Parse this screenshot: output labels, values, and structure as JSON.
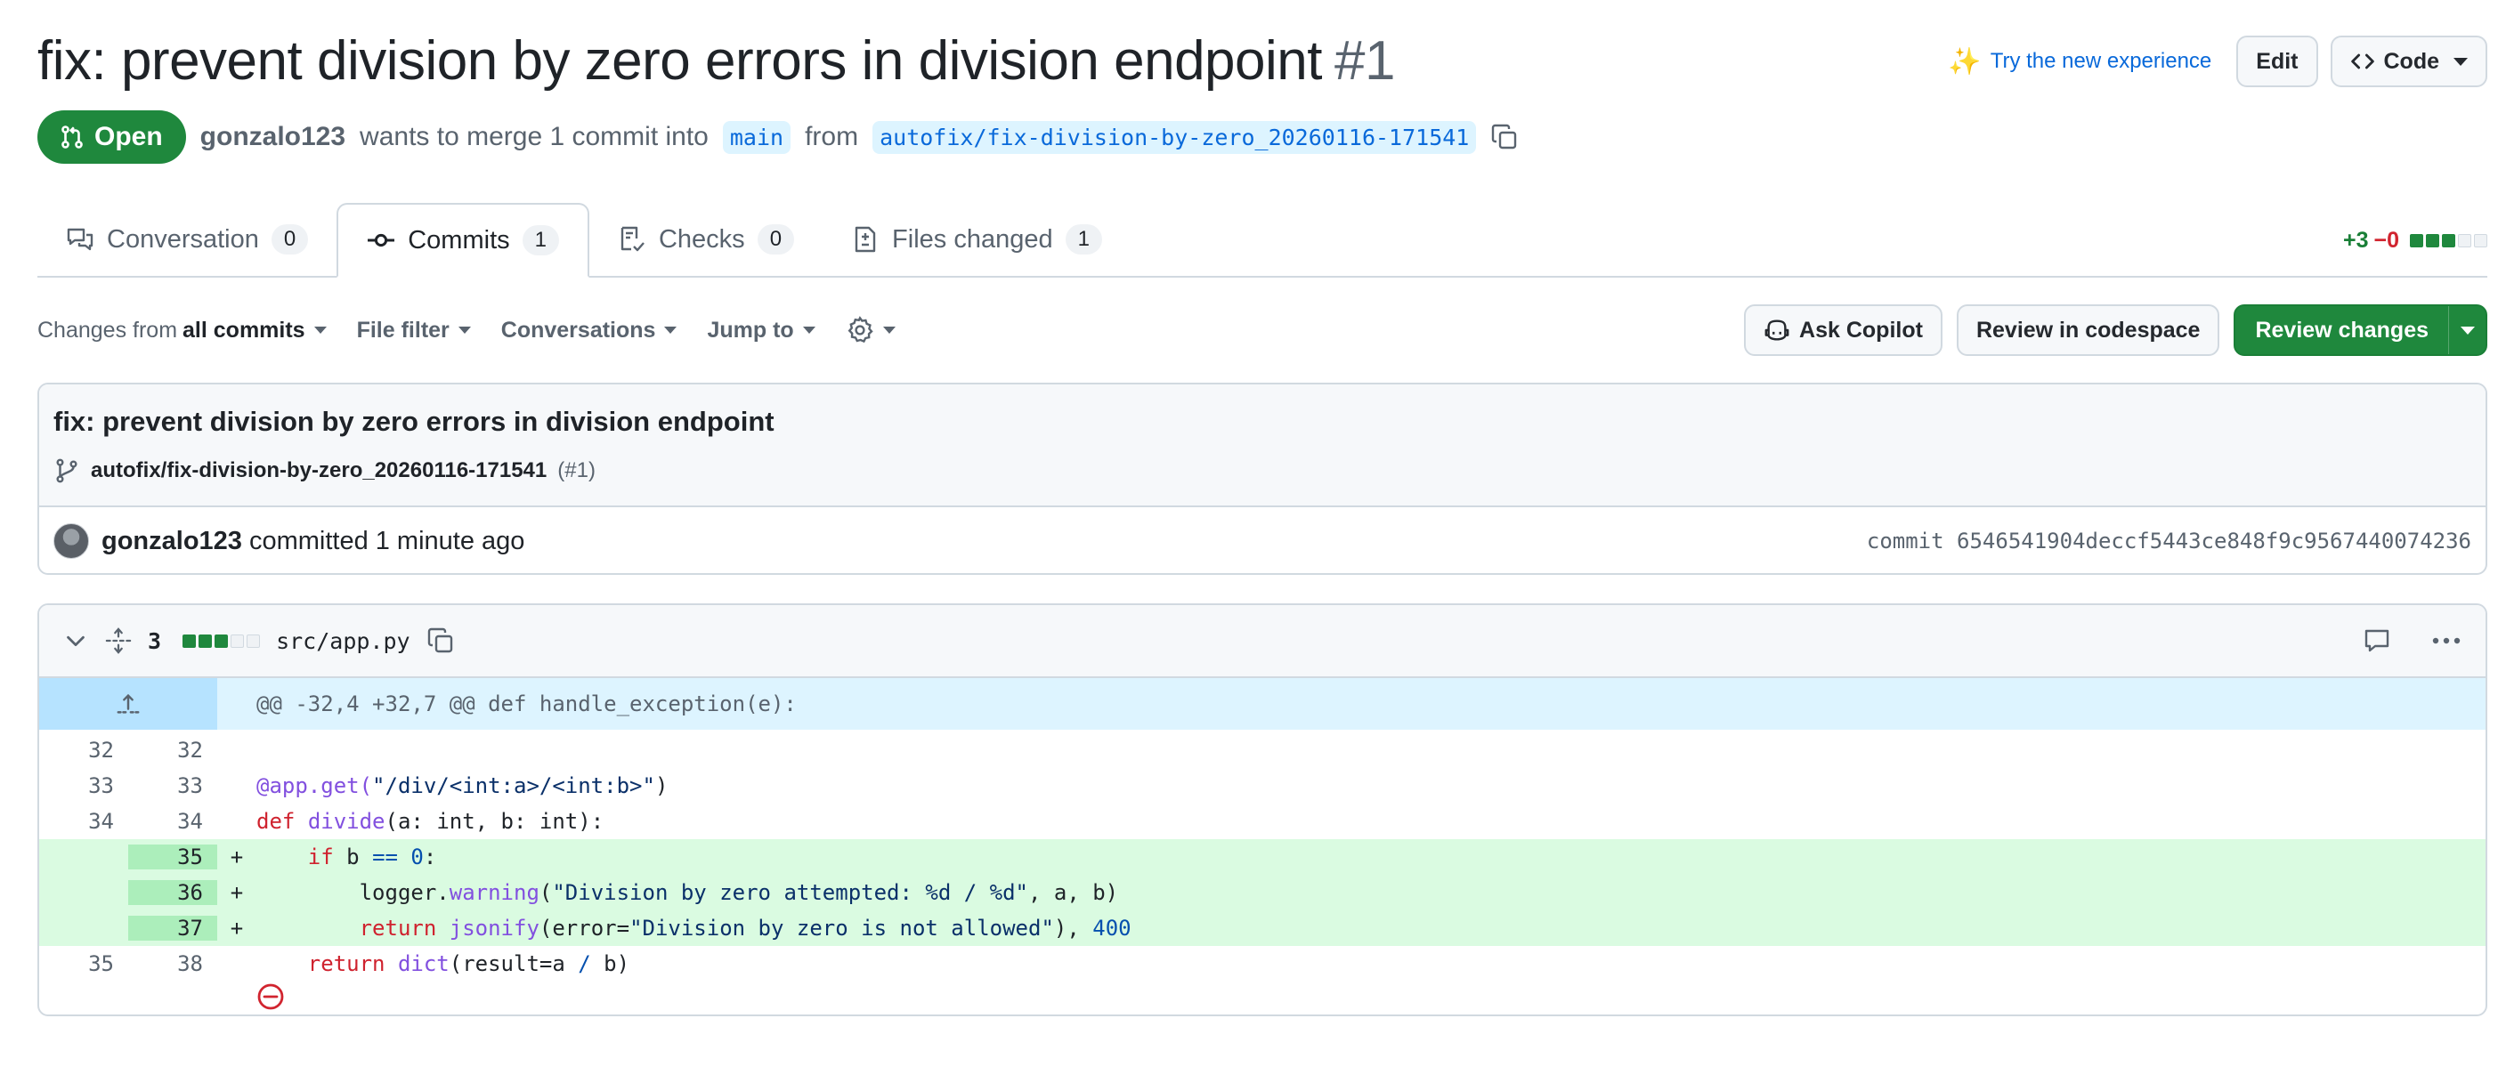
{
  "header": {
    "title": "fix: prevent division by zero errors in division endpoint",
    "number": "#1",
    "try_new": "Try the new experience",
    "edit": "Edit",
    "code": "Code"
  },
  "meta": {
    "state": "Open",
    "author": "gonzalo123",
    "text_merge": "wants to merge 1 commit into",
    "base_branch": "main",
    "text_from": "from",
    "head_branch": "autofix/fix-division-by-zero_20260116-171541"
  },
  "tabs": [
    {
      "label": "Conversation",
      "count": "0"
    },
    {
      "label": "Commits",
      "count": "1"
    },
    {
      "label": "Checks",
      "count": "0"
    },
    {
      "label": "Files changed",
      "count": "1"
    }
  ],
  "diffstat": {
    "additions": "+3",
    "deletions": "−0"
  },
  "toolbar": {
    "changes_from": "Changes from",
    "all_commits": "all commits",
    "file_filter": "File filter",
    "conversations": "Conversations",
    "jump_to": "Jump to",
    "ask_copilot": "Ask Copilot",
    "review_codespace": "Review in codespace",
    "review_changes": "Review changes"
  },
  "commit": {
    "message": "fix: prevent division by zero errors in division endpoint",
    "branch": "autofix/fix-division-by-zero_20260116-171541",
    "pr_ref": "(#1)",
    "author": "gonzalo123",
    "action": "committed 1 minute ago",
    "hash": "commit 6546541904deccf5443ce848f9c9567440074236"
  },
  "diff": {
    "changes": "3",
    "filename": "src/app.py",
    "hunk": "@@ -32,4 +32,7 @@ def handle_exception(e):",
    "lines": [
      {
        "old": "32",
        "new": "32",
        "marker": "",
        "type": "context"
      },
      {
        "old": "33",
        "new": "33",
        "marker": "",
        "type": "context"
      },
      {
        "old": "34",
        "new": "34",
        "marker": "",
        "type": "context"
      },
      {
        "old": "",
        "new": "35",
        "marker": "+",
        "type": "added"
      },
      {
        "old": "",
        "new": "36",
        "marker": "+",
        "type": "added"
      },
      {
        "old": "",
        "new": "37",
        "marker": "+",
        "type": "added"
      },
      {
        "old": "35",
        "new": "38",
        "marker": "",
        "type": "context"
      }
    ],
    "code": {
      "l33_deco": "@app.get(",
      "l33_str": "\"/div/<int:a>/<int:b>\"",
      "l33_end": ")",
      "l34_kw": "def",
      "l34_fn": "divide",
      "l34_rest": "(a: int, b: int):",
      "l35_indent": "    ",
      "l35_kw": "if",
      "l35_b": " b ",
      "l35_op": "==",
      "l35_sp": " ",
      "l35_num": "0",
      "l35_end": ":",
      "l36_indent": "        logger.",
      "l36_fn": "warning",
      "l36_open": "(",
      "l36_str": "\"Division by zero attempted: %d / %d\"",
      "l36_end": ", a, b)",
      "l37_indent": "        ",
      "l37_kw": "return",
      "l37_sp": " ",
      "l37_fn": "jsonify",
      "l37_open": "(error=",
      "l37_str": "\"Division by zero is not allowed\"",
      "l37_mid": "), ",
      "l37_num": "400",
      "l38_indent": "    ",
      "l38_kw": "return",
      "l38_sp": " ",
      "l38_fn": "dict",
      "l38_open": "(result=a ",
      "l38_op": "/",
      "l38_end": " b)"
    }
  },
  "colors": {
    "accent": "#0969da",
    "success": "#1f883d",
    "danger": "#d1242f"
  }
}
